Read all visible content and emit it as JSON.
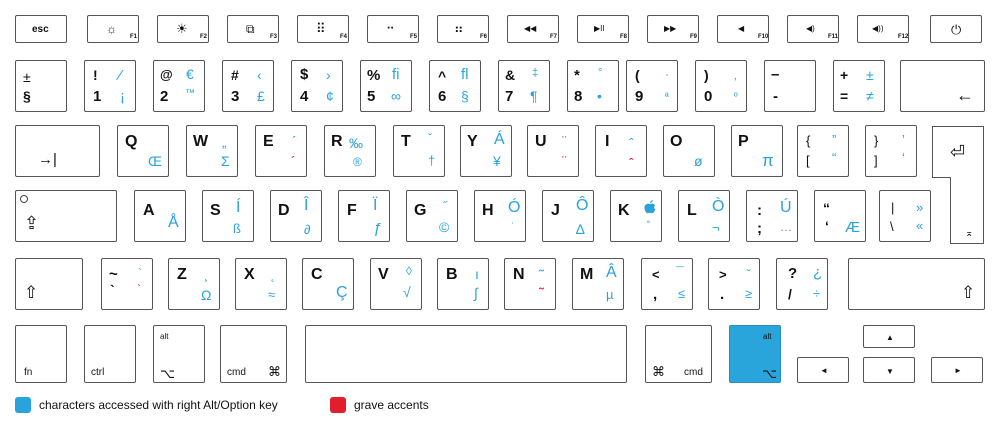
{
  "fn_row": {
    "esc": "esc",
    "f1": "F1",
    "f2": "F2",
    "f3": "F3",
    "f4": "F4",
    "f5": "F5",
    "f6": "F6",
    "f7": "F7",
    "f8": "F8",
    "f9": "F9",
    "f10": "F10",
    "f11": "F11",
    "f12": "F12",
    "icons": {
      "f1": "☼",
      "f2": "☀",
      "f3": "⧉",
      "f4": "⠿",
      "f5": "⠒",
      "f6": "⠶",
      "f7": "◀◀",
      "f8": "▶II",
      "f9": "▶▶",
      "f10": "◀",
      "f11": "◀)",
      "f12": "◀))",
      "power": "⏻"
    }
  },
  "num_row": {
    "section": {
      "top": "±",
      "bottom": "§"
    },
    "k1": {
      "shift": "!",
      "base": "1",
      "alt_shift": "⁄",
      "alt": "¡"
    },
    "k2": {
      "shift": "@",
      "base": "2",
      "alt_shift": "€",
      "alt": "™"
    },
    "k3": {
      "shift": "#",
      "base": "3",
      "alt_shift": "‹",
      "alt": "£"
    },
    "k4": {
      "shift": "$",
      "base": "4",
      "alt_shift": "›",
      "alt": "¢"
    },
    "k5": {
      "shift": "%",
      "base": "5",
      "alt_shift": "ﬁ",
      "alt": "∞"
    },
    "k6": {
      "shift": "^",
      "base": "6",
      "alt_shift": "ﬂ",
      "alt": "§"
    },
    "k7": {
      "shift": "&",
      "base": "7",
      "alt_shift": "‡",
      "alt": "¶"
    },
    "k8": {
      "shift": "*",
      "base": "8",
      "alt_shift": "°",
      "alt": "•"
    },
    "k9": {
      "shift": "(",
      "base": "9",
      "alt_shift": "·",
      "alt": "ª"
    },
    "k0": {
      "shift": ")",
      "base": "0",
      "alt_shift": "‚",
      "alt": "º"
    },
    "minus": {
      "shift": "–",
      "base": "-",
      "alt_shift": "—",
      "alt": "–"
    },
    "equal": {
      "shift": "+",
      "base": "=",
      "alt_shift": "±",
      "alt": "≠"
    },
    "backspace": "←"
  },
  "q_row": {
    "tab": "→|",
    "q": {
      "base": "Q",
      "alt": "Œ"
    },
    "w": {
      "base": "W",
      "alt_shift": "„",
      "alt": "Σ"
    },
    "e": {
      "base": "E",
      "alt_shift": "´",
      "alt": "´"
    },
    "r": {
      "base": "R",
      "alt_shift": "‰",
      "alt": "®"
    },
    "t": {
      "base": "T",
      "alt_shift": "ˇ",
      "alt": "†"
    },
    "y": {
      "base": "Y",
      "alt_shift": "Á",
      "alt": "¥"
    },
    "u": {
      "base": "U",
      "alt_shift": "¨",
      "alt": "¨"
    },
    "i": {
      "base": "I",
      "alt_shift": "ˆ",
      "alt": "ˆ"
    },
    "o": {
      "base": "O",
      "alt": "ø"
    },
    "p": {
      "base": "P",
      "alt": "π"
    },
    "lbracket": {
      "shift": "{",
      "base": "[",
      "alt_shift": "”",
      "alt": "“"
    },
    "rbracket": {
      "shift": "}",
      "base": "]",
      "alt_shift": "’",
      "alt": "‘"
    },
    "enter": "⏎"
  },
  "a_row": {
    "caps": "⇪",
    "a": {
      "base": "A",
      "alt": "Å"
    },
    "s": {
      "base": "S",
      "alt_shift": "Í",
      "alt": "ß"
    },
    "d": {
      "base": "D",
      "alt_shift": "Î",
      "alt": "∂"
    },
    "f": {
      "base": "F",
      "alt_shift": "Ï",
      "alt": "ƒ"
    },
    "g": {
      "base": "G",
      "alt_shift": "˝",
      "alt": "©"
    },
    "h": {
      "base": "H",
      "alt_shift": "Ó",
      "alt": "˙"
    },
    "j": {
      "base": "J",
      "alt_shift": "Ô",
      "alt": "∆"
    },
    "k": {
      "base": "K",
      "alt_shift": "",
      "alt": "˚"
    },
    "l": {
      "base": "L",
      "alt_shift": "Ò",
      "alt": "¬"
    },
    "semicolon": {
      "shift": ":",
      "base": ";",
      "alt_shift": "Ú",
      "alt": "…"
    },
    "quote": {
      "shift": "“",
      "base": "‘",
      "alt": "Æ"
    },
    "backslash": {
      "shift": "|",
      "base": "\\",
      "alt_shift": "»",
      "alt": "«"
    },
    "enter_lower": "⌅"
  },
  "z_row": {
    "shift_left": "⇧",
    "tilde": {
      "shift": "~",
      "base": "`",
      "alt_shift": "`",
      "alt": "`"
    },
    "z": {
      "base": "Z",
      "alt_shift": "¸",
      "alt": "Ω"
    },
    "x": {
      "base": "X",
      "alt_shift": "˛",
      "alt": "≈"
    },
    "c": {
      "base": "C",
      "alt": "Ç"
    },
    "v": {
      "base": "V",
      "alt_shift": "◊",
      "alt": "√"
    },
    "b": {
      "base": "B",
      "alt_shift": "ı",
      "alt": "∫"
    },
    "n": {
      "base": "N",
      "alt_shift": "˜",
      "alt": "˜"
    },
    "m": {
      "base": "M",
      "alt_shift": "Â",
      "alt": "µ"
    },
    "comma": {
      "shift": "<",
      "base": ",",
      "alt_shift": "¯",
      "alt": "≤"
    },
    "period": {
      "shift": ">",
      "base": ".",
      "alt_shift": "˘",
      "alt": "≥"
    },
    "slash": {
      "shift": "?",
      "base": "/",
      "alt_shift": "¿",
      "alt": "÷"
    },
    "shift_right": "⇧"
  },
  "bottom_row": {
    "fn": "fn",
    "ctrl": "ctrl",
    "alt_left": {
      "top": "alt",
      "symbol": "⌥"
    },
    "cmd_left": {
      "label": "cmd",
      "symbol": "⌘"
    },
    "cmd_right": {
      "label": "cmd",
      "symbol": "⌘"
    },
    "alt_right": {
      "top": "alt",
      "symbol": "⌥"
    },
    "arrows": {
      "up": "▲",
      "left": "◄",
      "down": "▼",
      "right": "►"
    }
  },
  "legend": {
    "alt_label": "characters accessed with right Alt/Option key",
    "grave_label": "grave accents",
    "alt_color": "#29a3dc",
    "grave_color": "#e21d2c"
  }
}
